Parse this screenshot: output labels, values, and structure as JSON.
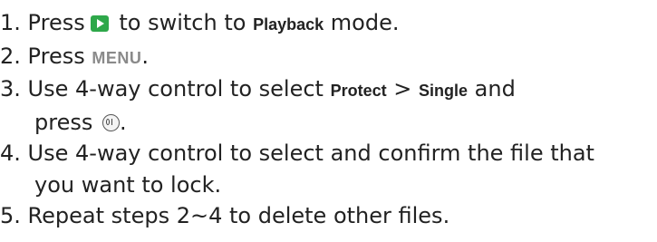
{
  "steps": [
    {
      "number": "1.",
      "prefix": "Press",
      "icon": "playback-icon",
      "icon_color": "#2ea84a",
      "middle": "to switch to",
      "bold": "Playback",
      "suffix": "mode."
    },
    {
      "number": "2.",
      "prefix": "Press",
      "key": "MENU",
      "suffix": "."
    },
    {
      "number": "3.",
      "prefix": "Use 4-way control to select",
      "bold1": "Protect",
      "sep": ">",
      "bold2": "Single",
      "suffix": "and",
      "line2_prefix": "press",
      "line2_icon": "ok-button-icon",
      "line2_suffix": "."
    },
    {
      "number": "4.",
      "line1": "Use 4-way control to select and confirm the file that",
      "line2": "you want to lock."
    },
    {
      "number": "5.",
      "text": "Repeat steps 2~4 to delete other files."
    }
  ]
}
